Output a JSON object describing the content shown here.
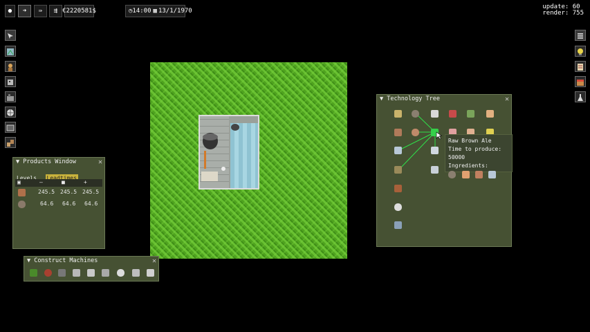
{
  "topbar": {
    "stop_icon": "stop-icon",
    "play_icon": "play-icon",
    "fast_icon": "fast-forward-icon",
    "fastest_icon": "fastest-forward-icon",
    "money": "€2220581$",
    "time": "14:00",
    "date": "13/1/1970",
    "time_icon": "clock-icon",
    "date_icon": "calendar-icon"
  },
  "stats": {
    "update": "update: 60",
    "render": "render: 755"
  },
  "left_toolbar": [
    "select-tool-icon",
    "map-tool-icon",
    "worker-icon",
    "robot-icon",
    "machine-icon",
    "globe-icon",
    "screen-icon",
    "boxes-icon"
  ],
  "right_toolbar": [
    "menu-icon",
    "idea-icon",
    "scroll-icon",
    "store-icon",
    "flask-icon"
  ],
  "products_window": {
    "title": "Products Window",
    "tabs": [
      "Levels",
      "Leadtimes"
    ],
    "active_tab": "Leadtimes",
    "header_symbols": [
      "–",
      "■",
      "+"
    ],
    "rows": [
      {
        "icon": "hourglass-product-icon",
        "values": [
          "245.5",
          "245.5",
          "245.5"
        ]
      },
      {
        "icon": "barrel-product-icon",
        "values": [
          "64.6",
          "64.6",
          "64.6"
        ]
      }
    ]
  },
  "construct_machines": {
    "title": "Construct Machines",
    "machines": [
      "plant-machine-icon",
      "pin-machine-icon",
      "conveyor-machine-icon",
      "press-machine-icon",
      "mill-machine-icon",
      "distiller-machine-icon",
      "tank-machine-icon",
      "brewer-machine-icon",
      "packer-machine-icon"
    ]
  },
  "tech_tree": {
    "title": "Technology Tree",
    "tooltip": {
      "name": "Raw Brown Ale",
      "time_label": "Time to produce: 50000",
      "ingredients_label": "Ingredients:"
    }
  },
  "colors": {
    "panel": "#465133",
    "grass": "#56aa26",
    "link_line": "#2fe04a",
    "tab_active": "#c8b23c"
  }
}
